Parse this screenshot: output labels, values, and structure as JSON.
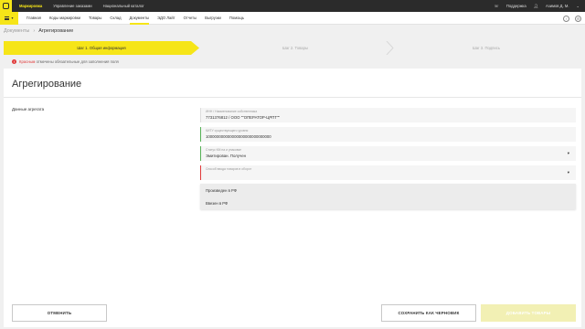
{
  "topbar": {
    "items": [
      "Маркировка",
      "Управление заказами",
      "Национальный каталог"
    ],
    "support_label": "Поддержка",
    "user_label": "Азимов Д. М."
  },
  "subnav": {
    "items": [
      "Главная",
      "Коды маркировки",
      "Товары",
      "Склад",
      "Документы",
      "ЭДО Лайт",
      "Отчеты",
      "Выгрузки",
      "Помощь"
    ],
    "active_index": 4
  },
  "breadcrumb": {
    "parent": "Документы",
    "current": "Агрегирование"
  },
  "steps": [
    "Шаг 1. Общая информация",
    "Шаг 2. Товары",
    "Шаг 3. Подпись"
  ],
  "notice": {
    "red_word": "Красным",
    "text": "отмечены обязательные для заполнения поля"
  },
  "form": {
    "title": "Агрегирование",
    "section_label": "Данные агрегата",
    "fields": [
      {
        "label": "ИНН / Наименование собственника",
        "value": "7731376812 / ООО \"\"ОПЕРАТОР-ЦРПТ\"\""
      },
      {
        "label": "КИТУ существующего уровня",
        "value": "100000000000000000000000000000"
      },
      {
        "label": "Статус КМ на и упаковке",
        "value": "Эмитирован. Получен"
      },
      {
        "label": "Способ ввода товаров в оборот",
        "value": ""
      }
    ],
    "dropdown_options": [
      "Произведен в РФ",
      "Ввезен в РФ"
    ]
  },
  "buttons": {
    "cancel": "ОТМЕНИТЬ",
    "save_draft": "СОХРАНИТЬ КАК ЧЕРНОВИК",
    "add_goods": "ДОБАВИТЬ ТОВАРЫ"
  },
  "colors": {
    "accent": "#f6e518",
    "topbar": "#2b2b2b",
    "required": "#e03a3a",
    "valid": "#55b155"
  }
}
